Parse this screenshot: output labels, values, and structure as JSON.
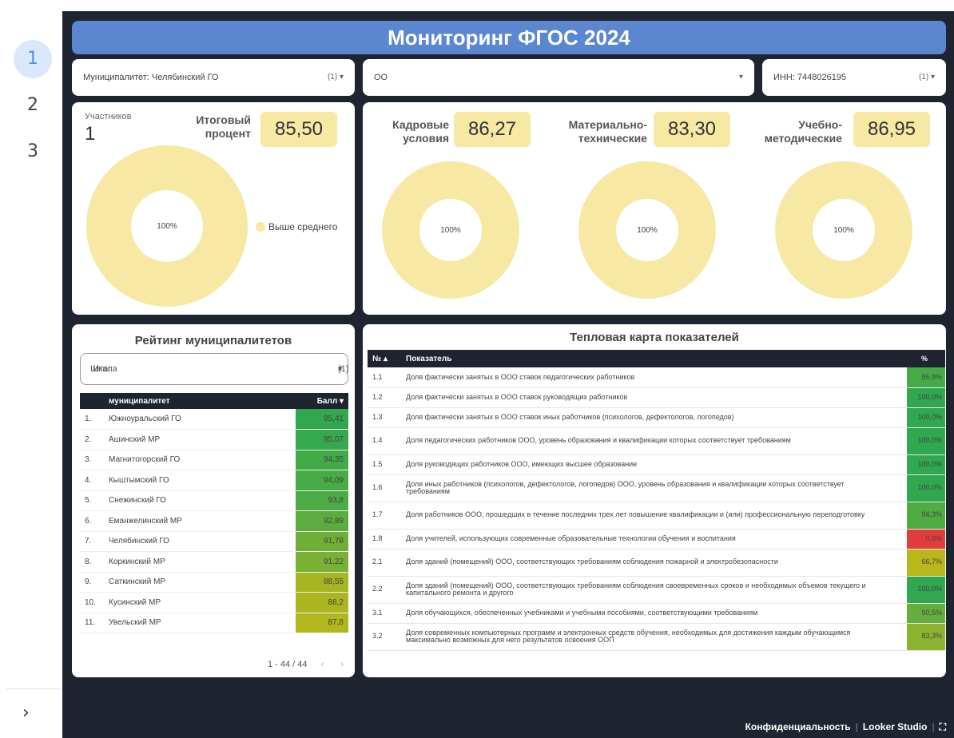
{
  "nav": {
    "pages": [
      "1",
      "2",
      "3"
    ],
    "expand": "›"
  },
  "title": "Мониторинг ФГОС 2024",
  "filters": {
    "municipality": {
      "label": "Муниципалитет",
      "value": "Челябинский ГО",
      "count": "(1)"
    },
    "oo": {
      "value": "ОО"
    },
    "inn": {
      "label": "ИНН",
      "value": "7448026195",
      "count": "(1)"
    }
  },
  "summary": {
    "participants_label": "Участников",
    "participants_value": "1",
    "total_label_1": "Итоговый",
    "total_label_2": "процент",
    "total_value": "85,50",
    "donut_pct": "100%",
    "legend": "Выше среднего"
  },
  "metrics": [
    {
      "l1": "Кадровые",
      "l2": "условия",
      "value": "86,27",
      "pct": "100%"
    },
    {
      "l1": "Материально-",
      "l2": "технические",
      "value": "83,30",
      "pct": "100%"
    },
    {
      "l1": "Учебно-",
      "l2": "методические",
      "value": "86,95",
      "pct": "100%"
    }
  ],
  "ranking": {
    "title": "Рейтинг муниципалитетов",
    "scale_label": "Шкала",
    "scale_value": "Итог",
    "scale_count": "(1)",
    "col_name": "муниципалитет",
    "col_score": "Балл",
    "rows": [
      {
        "n": "1.",
        "name": "Южноуральский ГО",
        "score": "95,41"
      },
      {
        "n": "2.",
        "name": "Ашинский МР",
        "score": "95,07"
      },
      {
        "n": "3.",
        "name": "Магнитогорский ГО",
        "score": "94,35"
      },
      {
        "n": "4.",
        "name": "Кыштымский ГО",
        "score": "94,09"
      },
      {
        "n": "5.",
        "name": "Снежинский ГО",
        "score": "93,8"
      },
      {
        "n": "6.",
        "name": "Еманжелинский МР",
        "score": "92,89"
      },
      {
        "n": "7.",
        "name": "Челябинский ГО",
        "score": "91,78"
      },
      {
        "n": "8.",
        "name": "Коркинский МР",
        "score": "91,22"
      },
      {
        "n": "9.",
        "name": "Саткинский МР",
        "score": "88,55"
      },
      {
        "n": "10.",
        "name": "Кусинский МР",
        "score": "88,2"
      },
      {
        "n": "11.",
        "name": "Увельский МР",
        "score": "87,8"
      }
    ],
    "pager": "1 - 44 / 44"
  },
  "heatmap": {
    "title": "Тепловая карта показателей",
    "col_num": "№",
    "col_name": "Показатель",
    "col_pct": "%",
    "rows": [
      {
        "n": "1.1",
        "text": "Доля фактически занятых в ООО ставок педагогических работников",
        "pct": "95,9%"
      },
      {
        "n": "1.2",
        "text": "Доля фактически занятых в ООО ставок руководящих работников",
        "pct": "100,0%"
      },
      {
        "n": "1.3",
        "text": "Доля фактически занятых в ООО ставок иных работников (психологов, дефектологов, логопедов)",
        "pct": "100,0%"
      },
      {
        "n": "1.4",
        "text": "Доля педагогических работников ООО, уровень образования и квалификации которых соответствует требованиям",
        "pct": "100,0%"
      },
      {
        "n": "1.5",
        "text": "Доля руководящих работников ООО, имеющих высшее образование",
        "pct": "100,0%"
      },
      {
        "n": "1.6",
        "text": "Доля иных работников (психологов, дефектологов, логопедов) ООО, уровень образования и квалификации которых соответствует требованиям",
        "pct": "100,0%"
      },
      {
        "n": "1.7",
        "text": "Доля работников ООО, прошедших в течение последних трех лет повышение квалификации и (или) профессиональную переподготовку",
        "pct": "94,3%"
      },
      {
        "n": "1.8",
        "text": "Доля учителей, использующих современные образовательные технологии обучения и воспитания",
        "pct": "0,0%"
      },
      {
        "n": "2.1",
        "text": "Доля зданий (помещений) ООО, соответствующих требованиям соблюдения пожарной и электробезопасности",
        "pct": "66,7%"
      },
      {
        "n": "2.2",
        "text": "Доля зданий (помещений) ООО, соответствующих требованиям соблюдения своевременных сроков и необходимых объемов текущего и капитального ремонта и другого",
        "pct": "100,0%"
      },
      {
        "n": "3.1",
        "text": "Доля обучающихся, обеспеченных учебниками и учебными пособиями, соответствующими требованиям",
        "pct": "90,5%"
      },
      {
        "n": "3.2",
        "text": "Доля современных компьютерных программ и электронных средств обучения, необходимых для достижения каждым обучающимся максимально возможных для него результатов освоения ООП",
        "pct": "83,3%"
      }
    ]
  },
  "footer": {
    "privacy": "Конфиденциальность",
    "brand": "Looker Studio"
  },
  "colors": {
    "canvas": "#1f2431",
    "title": "#5b87d0",
    "kpi": "#f7e8a4",
    "green": "#2fa84f",
    "yellow": "#b8b81c",
    "red": "#e23b3b"
  }
}
